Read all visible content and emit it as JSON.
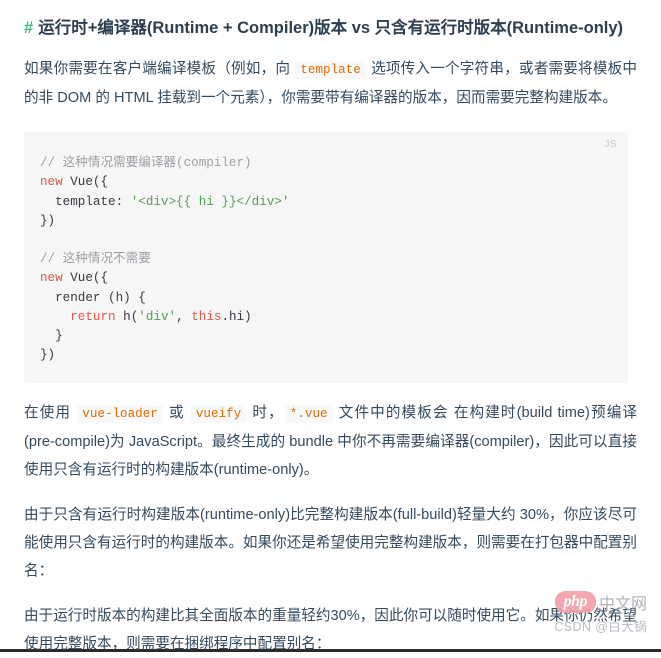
{
  "heading": {
    "anchor": "#",
    "text": "运行时+编译器(Runtime + Compiler)版本 vs 只含有运行时版本(Runtime-only)"
  },
  "paragraphs": {
    "p1": {
      "part1": "如果你需要在客户端编译模板（例如，向 ",
      "code1": "template",
      "part2": " 选项传入一个字符串，或者需要将模板中的非 DOM 的 HTML 挂载到一个元素），你需要带有编译器的版本，因而需要完整构建版本。"
    },
    "p2": {
      "part1": "在使用 ",
      "code1": "vue-loader",
      "part2": " 或 ",
      "code2": "vueify",
      "part3": " 时，",
      "code3": "*.vue",
      "part4": " 文件中的模板会 在构建时(build time)预编译(pre-compile)为 JavaScript。最终生成的 bundle 中你不再需要编译器(compiler)，因此可以直接使用只含有运行时的构建版本(runtime-only)。"
    },
    "p3": "由于只含有运行时构建版本(runtime-only)比完整构建版本(full-build)轻量大约 30%，你应该尽可能使用只含有运行时的构建版本。如果你还是希望使用完整构建版本，则需要在打包器中配置别名：",
    "p4": "由于运行时版本的构建比其全面版本的重量轻约30%，因此你可以随时使用它。如果你仍然希望使用完整版本，则需要在捆绑程序中配置别名："
  },
  "codeblock": {
    "lang_label": "JS",
    "lines": {
      "comment1": "// 这种情况需要编译器(compiler)",
      "kw_new": "new",
      "vue_open": " Vue({",
      "template_key": "  template: ",
      "template_val": "'<div>{{ hi }}</div>'",
      "close1": "})",
      "comment2": "// 这种情况不需要",
      "render_line": "  render (h) {",
      "kw_return": "return",
      "return_fn": " h(",
      "div_str": "'div'",
      "comma": ", ",
      "kw_this": "this",
      "hi_prop": ".hi)",
      "brace_close": "  }",
      "close2": "})"
    }
  },
  "watermark": {
    "php": "php",
    "cn": "中文网",
    "csdn": "CSDN @白大锅"
  },
  "colors": {
    "anchor_green": "#42b983",
    "inline_code_orange": "#e96900",
    "code_bg": "#f6f6f6",
    "text": "#34495e",
    "keyword_red": "#e45649",
    "string_green": "#50a14f",
    "comment_gray": "#a0a1a7"
  }
}
